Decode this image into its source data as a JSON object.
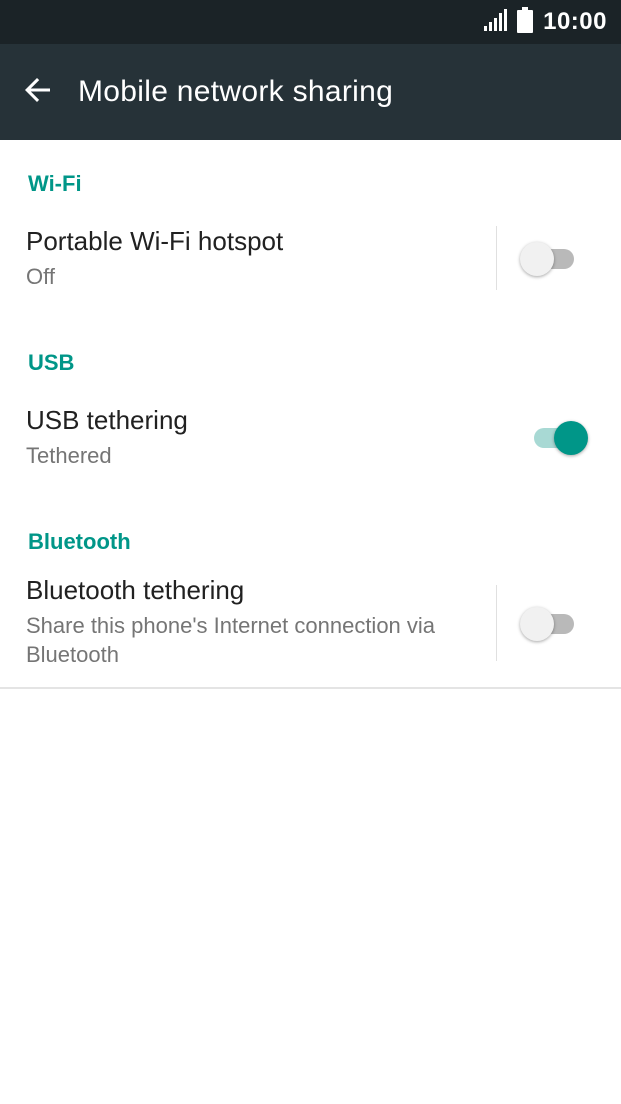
{
  "status_bar": {
    "time": "10:00",
    "signal_icon": "signal-icon",
    "battery_icon": "battery-icon"
  },
  "app_bar": {
    "back_icon": "arrow-back-icon",
    "title": "Mobile network sharing"
  },
  "sections": {
    "wifi": {
      "header": "Wi-Fi",
      "hotspot": {
        "title": "Portable Wi-Fi hotspot",
        "summary": "Off",
        "enabled": false
      }
    },
    "usb": {
      "header": "USB",
      "tethering": {
        "title": "USB tethering",
        "summary": "Tethered",
        "enabled": true
      }
    },
    "bluetooth": {
      "header": "Bluetooth",
      "tethering": {
        "title": "Bluetooth tethering",
        "summary_line1": "Share this phone's Internet connection via",
        "summary_line2": "Bluetooth",
        "enabled": false
      }
    }
  },
  "colors": {
    "accent": "#009688",
    "app_bar": "#263238",
    "status_bar": "#1b2327"
  }
}
